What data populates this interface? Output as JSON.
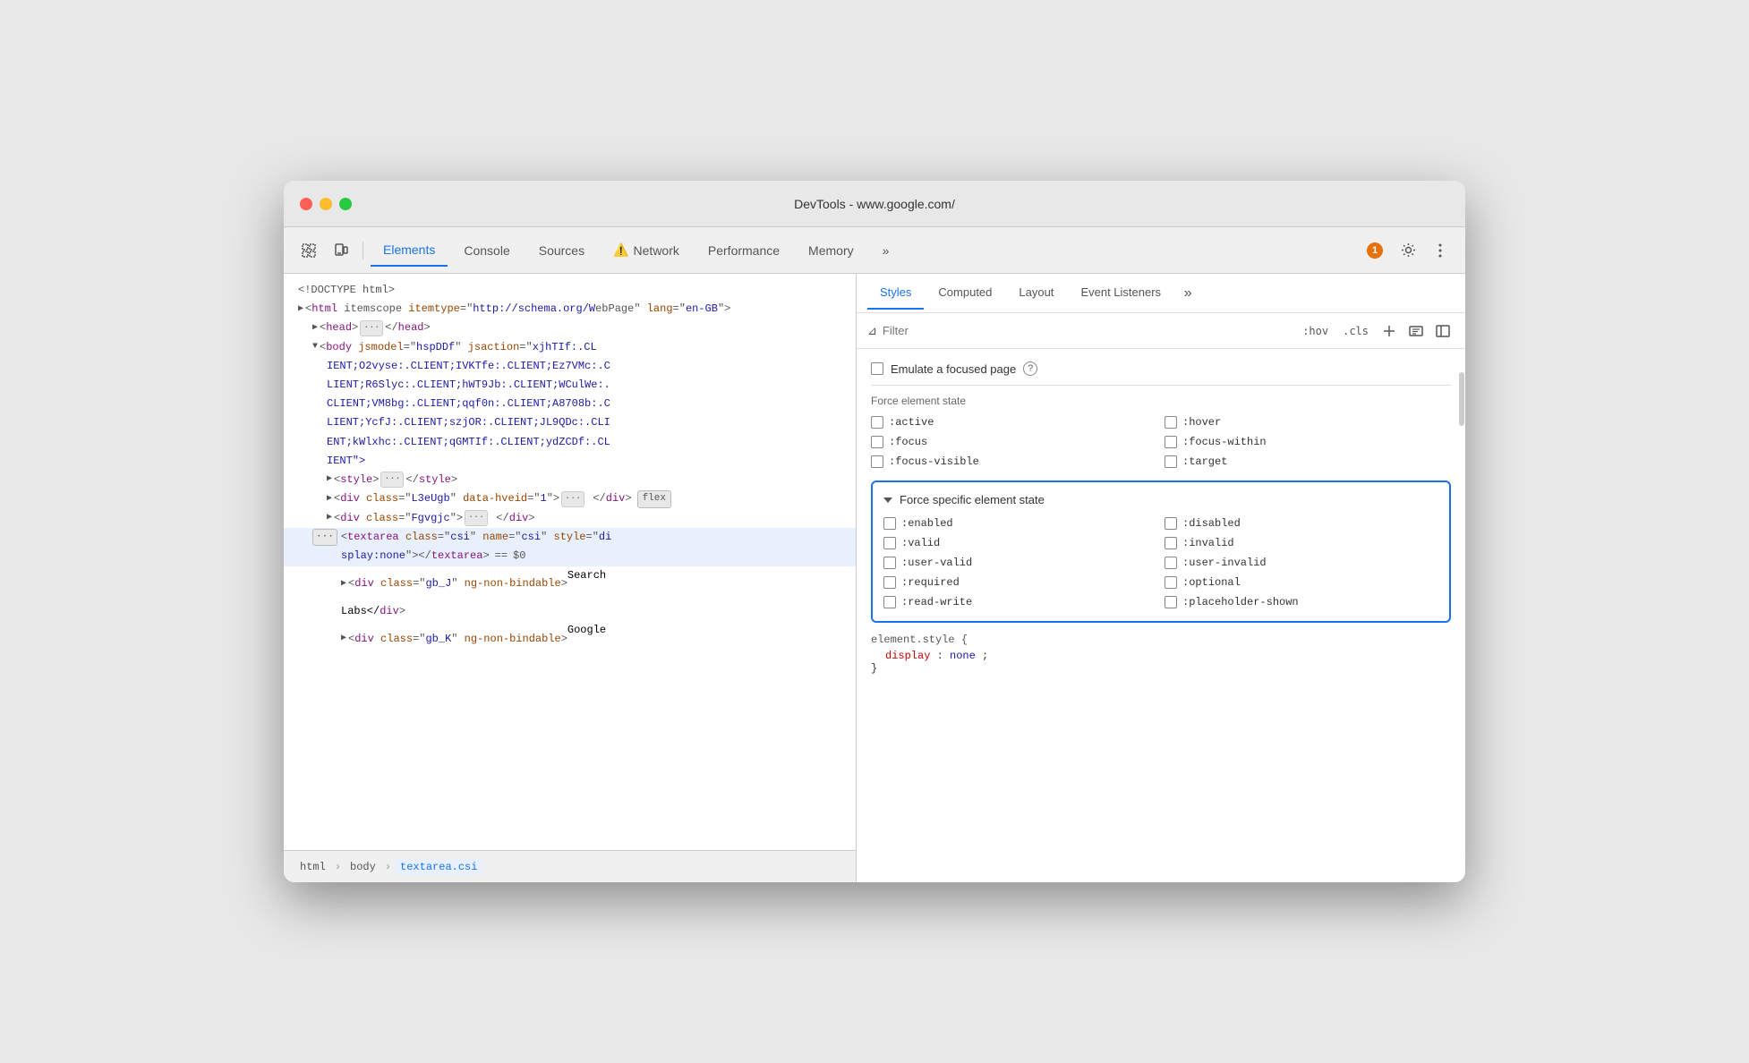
{
  "window": {
    "title": "DevTools - www.google.com/"
  },
  "toolbar": {
    "tabs": [
      {
        "id": "elements",
        "label": "Elements",
        "active": true,
        "warning": false
      },
      {
        "id": "console",
        "label": "Console",
        "active": false,
        "warning": false
      },
      {
        "id": "sources",
        "label": "Sources",
        "active": false,
        "warning": false
      },
      {
        "id": "network",
        "label": "Network",
        "active": false,
        "warning": true
      },
      {
        "id": "performance",
        "label": "Performance",
        "active": false,
        "warning": false
      },
      {
        "id": "memory",
        "label": "Memory",
        "active": false,
        "warning": false
      }
    ],
    "badge_count": "1",
    "more_tabs_label": "»"
  },
  "styles_panel": {
    "tabs": [
      {
        "id": "styles",
        "label": "Styles",
        "active": true
      },
      {
        "id": "computed",
        "label": "Computed",
        "active": false
      },
      {
        "id": "layout",
        "label": "Layout",
        "active": false
      },
      {
        "id": "event_listeners",
        "label": "Event Listeners",
        "active": false
      }
    ],
    "more_tabs": "»",
    "filter": {
      "placeholder": "Filter",
      "hov_label": ":hov",
      "cls_label": ".cls"
    },
    "emulate_label": "Emulate a focused page",
    "force_state_title": "Force element state",
    "force_states": [
      {
        "id": "active",
        "label": ":active"
      },
      {
        "id": "focus",
        "label": ":focus"
      },
      {
        "id": "focus-visible",
        "label": ":focus-visible"
      },
      {
        "id": "hover",
        "label": ":hover"
      },
      {
        "id": "focus-within",
        "label": ":focus-within"
      },
      {
        "id": "target",
        "label": ":target"
      }
    ],
    "force_specific_title": "Force specific element state",
    "force_specific_states": [
      {
        "id": "enabled",
        "label": ":enabled"
      },
      {
        "id": "valid",
        "label": ":valid"
      },
      {
        "id": "user-valid",
        "label": ":user-valid"
      },
      {
        "id": "required",
        "label": ":required"
      },
      {
        "id": "read-write",
        "label": ":read-write"
      },
      {
        "id": "disabled",
        "label": ":disabled"
      },
      {
        "id": "invalid",
        "label": ":invalid"
      },
      {
        "id": "user-invalid",
        "label": ":user-invalid"
      },
      {
        "id": "optional",
        "label": ":optional"
      },
      {
        "id": "placeholder-shown",
        "label": ":placeholder-shown"
      }
    ],
    "element_style": {
      "header": "element.style {",
      "property": "display",
      "value": "none",
      "footer": "}"
    }
  },
  "dom_panel": {
    "lines": [
      {
        "indent": 0,
        "content": "<!DOCTYPE html>",
        "type": "doctype"
      },
      {
        "indent": 0,
        "content": "",
        "type": "html_open"
      },
      {
        "indent": 1,
        "content": "",
        "type": "head"
      },
      {
        "indent": 1,
        "content": "",
        "type": "body_open"
      },
      {
        "indent": 2,
        "content": "",
        "type": "style"
      },
      {
        "indent": 2,
        "content": "",
        "type": "div_l3eUgb"
      },
      {
        "indent": 2,
        "content": "",
        "type": "div_Fvgjc"
      },
      {
        "indent": 2,
        "content": "",
        "type": "textarea_selected"
      },
      {
        "indent": 3,
        "content": "",
        "type": "div_gbJ"
      },
      {
        "indent": 3,
        "content": "",
        "type": "div_gbK"
      }
    ]
  },
  "breadcrumb": {
    "items": [
      {
        "label": "html",
        "active": false
      },
      {
        "label": "body",
        "active": false
      },
      {
        "label": "textarea.csi",
        "active": true
      }
    ]
  }
}
